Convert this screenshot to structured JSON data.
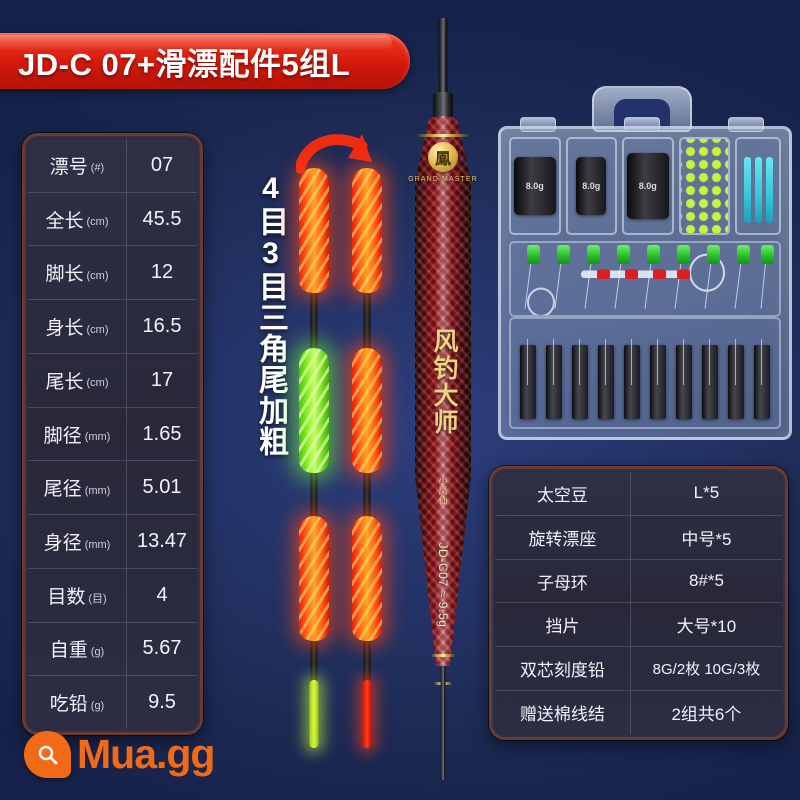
{
  "banner": {
    "title": "JD-C 07+滑漂配件5组L"
  },
  "spec_table": {
    "rows": [
      {
        "label": "漂号",
        "unit": "(#)",
        "value": "07"
      },
      {
        "label": "全长",
        "unit": "(cm)",
        "value": "45.5"
      },
      {
        "label": "脚长",
        "unit": "(cm)",
        "value": "12"
      },
      {
        "label": "身长",
        "unit": "(cm)",
        "value": "16.5"
      },
      {
        "label": "尾长",
        "unit": "(cm)",
        "value": "17"
      },
      {
        "label": "脚径",
        "unit": "(mm)",
        "value": "1.65"
      },
      {
        "label": "尾径",
        "unit": "(mm)",
        "value": "5.01"
      },
      {
        "label": "身径",
        "unit": "(mm)",
        "value": "13.47"
      },
      {
        "label": "目数",
        "unit": "(目)",
        "value": "4"
      },
      {
        "label": "自重",
        "unit": "(g)",
        "value": "5.67"
      },
      {
        "label": "吃铅",
        "unit": "(g)",
        "value": "9.5"
      }
    ]
  },
  "accessory_table": {
    "rows": [
      {
        "label": "太空豆",
        "value": "L*5"
      },
      {
        "label": "旋转漂座",
        "value": "中号*5"
      },
      {
        "label": "子母环",
        "value": "8#*5"
      },
      {
        "label": "挡片",
        "value": "大号*10"
      },
      {
        "label": "双芯刻度铅",
        "value": "8G/2枚 10G/3枚"
      },
      {
        "label": "赠送棉线结",
        "value": "2组共6个"
      }
    ]
  },
  "vertical_caption": {
    "text": "4目3目三角尾加粗"
  },
  "float": {
    "logo_glyph": "鳳",
    "brand_en": "GRAND MASTER",
    "brand_cn": "风钓大师",
    "seal": "小凤仙",
    "model": "JD-C07 ≈ 9.5g"
  },
  "tackle_box": {
    "weight_labels": [
      "8.0g",
      "8.0g",
      "8.0g"
    ]
  },
  "watermark": {
    "text": "Mua.gg"
  },
  "colors": {
    "banner_red": "#d4180c",
    "panel_bg": "#2a2a40",
    "panel_border": "#6b3a32",
    "background_navy": "#22306b",
    "watermark_orange": "#f36a16",
    "gold": "#e3bb53"
  }
}
